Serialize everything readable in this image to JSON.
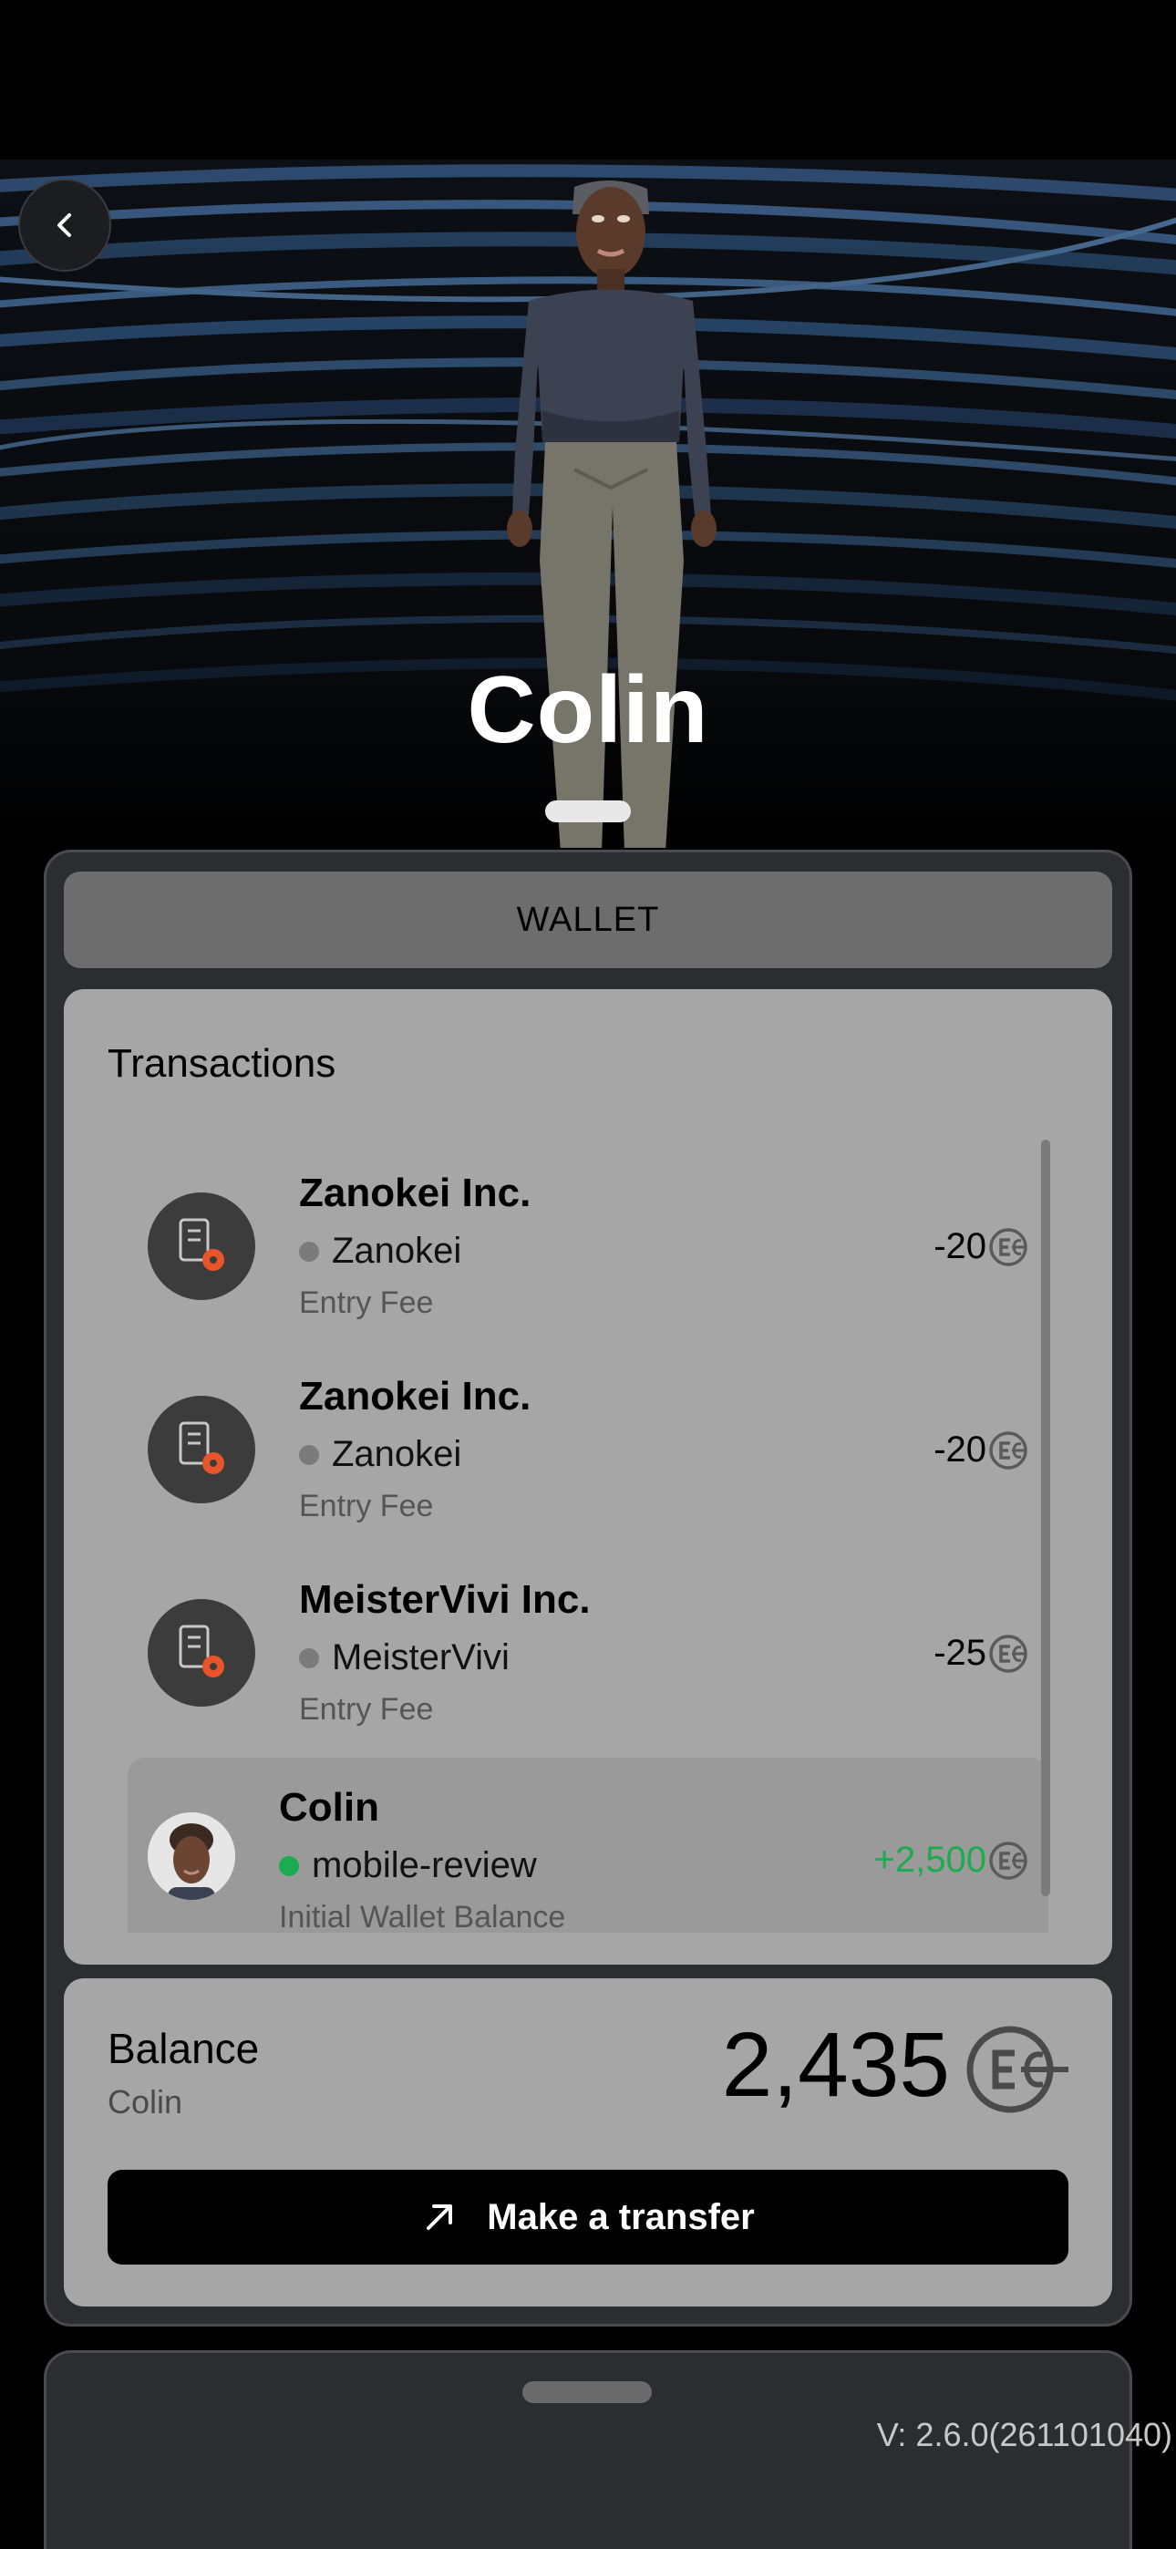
{
  "player": {
    "name": "Colin"
  },
  "wallet": {
    "tab_label": "WALLET"
  },
  "transactions": {
    "title": "Transactions",
    "items": [
      {
        "name": "Zanokei Inc.",
        "sub": "Zanokei",
        "description": "Entry Fee",
        "amount": "-20",
        "icon": "company-icon",
        "dot_color": "#7a7a7a",
        "positive": false
      },
      {
        "name": "Zanokei Inc.",
        "sub": "Zanokei",
        "description": "Entry Fee",
        "amount": "-20",
        "icon": "company-icon",
        "dot_color": "#7a7a7a",
        "positive": false
      },
      {
        "name": "MeisterVivi Inc.",
        "sub": "MeisterVivi",
        "description": "Entry Fee",
        "amount": "-25",
        "icon": "company-icon",
        "dot_color": "#7a7a7a",
        "positive": false
      },
      {
        "name": "Colin",
        "sub": "mobile-review",
        "description": "Initial Wallet Balance",
        "amount": "+2,500",
        "icon": "user-avatar",
        "dot_color": "#1dab4f",
        "positive": true
      }
    ]
  },
  "balance": {
    "label": "Balance",
    "user": "Colin",
    "amount": "2,435"
  },
  "transfer": {
    "label": "Make a transfer"
  },
  "version": "V: 2.6.0(261101040)",
  "colors": {
    "positive": "#1dab4f",
    "card": "#a6a6a6",
    "panel": "#2c2d30"
  }
}
